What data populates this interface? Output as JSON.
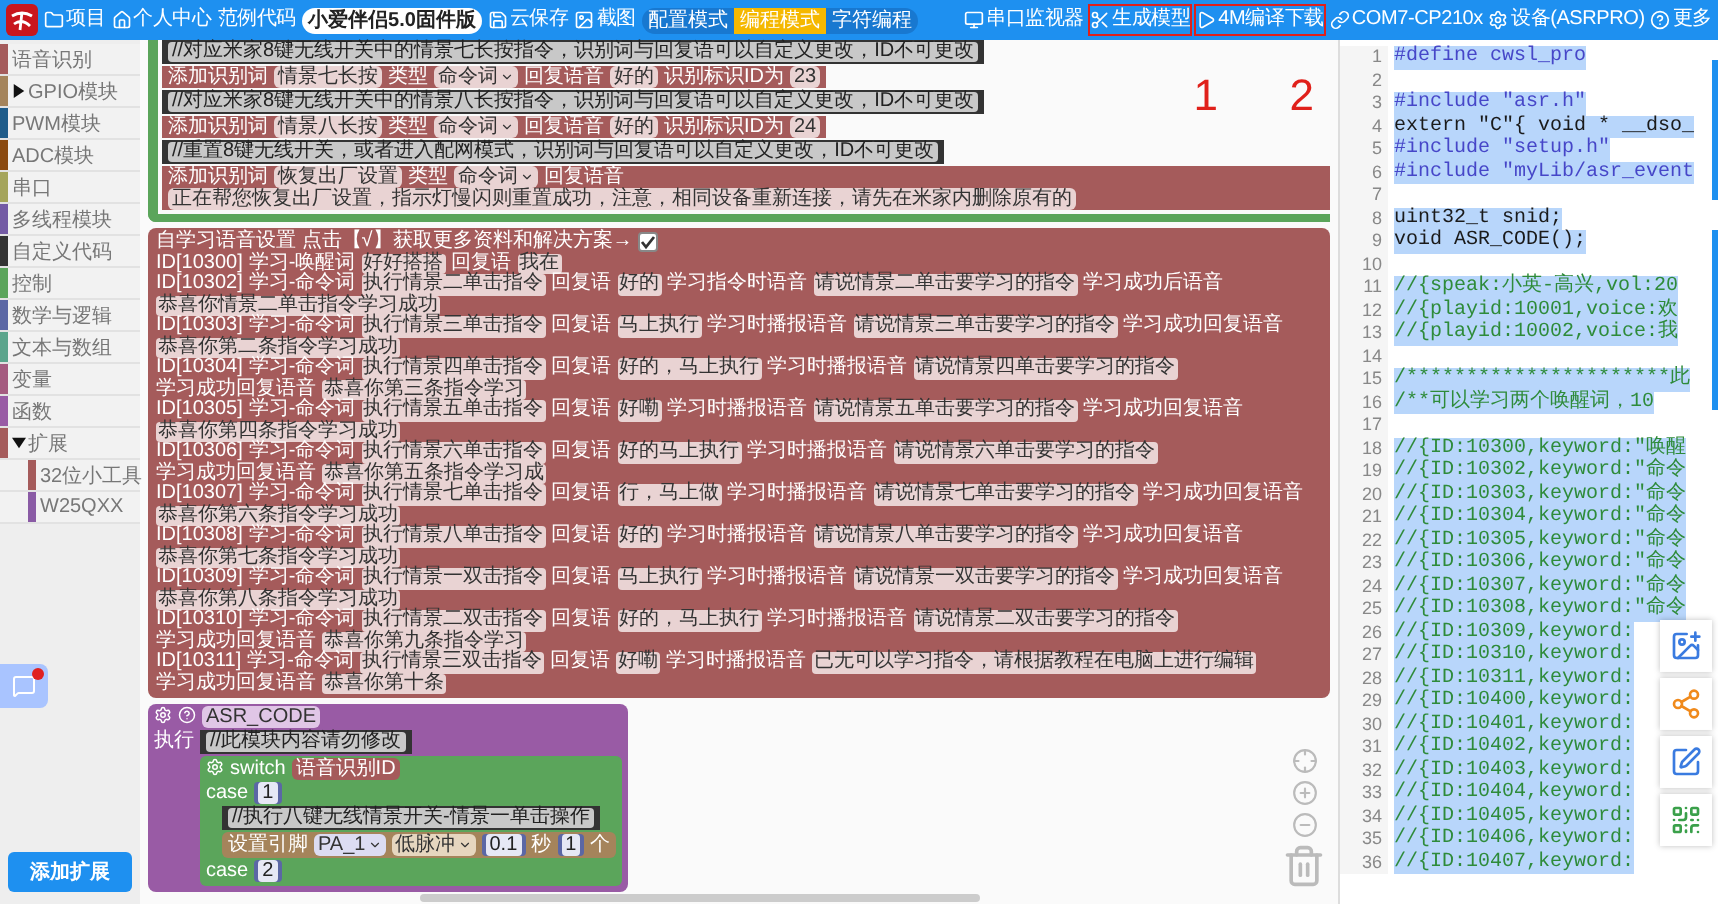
{
  "top_bar": {
    "nav": [
      {
        "label": "项目"
      },
      {
        "label": "个人中心"
      },
      {
        "label": "范例代码"
      }
    ],
    "firmware": "小爱伴侣5.0固件版",
    "file_actions": [
      {
        "label": "云保存"
      },
      {
        "label": "截图"
      }
    ],
    "modes": [
      {
        "label": "配置模式",
        "selected": false
      },
      {
        "label": "编程模式",
        "selected": true
      },
      {
        "label": "字符编程",
        "selected": false
      }
    ],
    "tools": [
      {
        "label": "串口监视器",
        "highlighted": false
      },
      {
        "label": "生成模型",
        "highlighted": true
      },
      {
        "label": "4M编译下载",
        "highlighted": true
      },
      {
        "label": "COM7-CP210x",
        "highlighted": false
      },
      {
        "label": "设备(ASRPRO)",
        "highlighted": false
      },
      {
        "label": "更多",
        "highlighted": false
      }
    ]
  },
  "sidebar": {
    "items": [
      {
        "label": "语音识别",
        "color": "#a55b5b",
        "kind": "category"
      },
      {
        "label": "GPIO模块",
        "color": "#a5845b",
        "kind": "group",
        "expanded": false
      },
      {
        "label": "PWM模块",
        "color": "#1f5c8a",
        "kind": "category"
      },
      {
        "label": "ADC模块",
        "color": "#8a4a10",
        "kind": "category"
      },
      {
        "label": "串口",
        "color": "#a5a55b",
        "kind": "category"
      },
      {
        "label": "多线程模块",
        "color": "#745ba5",
        "kind": "category"
      },
      {
        "label": "自定义代码",
        "color": "#333333",
        "kind": "category"
      },
      {
        "label": "控制",
        "color": "#5ba55b",
        "kind": "category"
      },
      {
        "label": "数学与逻辑",
        "color": "#5b67a5",
        "kind": "category"
      },
      {
        "label": "文本与数组",
        "color": "#5ba58c",
        "kind": "category"
      },
      {
        "label": "变量",
        "color": "#a55b80",
        "kind": "category"
      },
      {
        "label": "函数",
        "color": "#995ba5",
        "kind": "category"
      },
      {
        "label": "扩展",
        "color": "#a55b5b",
        "kind": "group",
        "expanded": true,
        "children": [
          {
            "label": "32位小工具",
            "color": "#a55b5b"
          },
          {
            "label": "W25QXX",
            "color": "#8a5ba5"
          }
        ]
      }
    ],
    "add_button": "添加扩展"
  },
  "workspace": {
    "annotations": [
      {
        "label": "1"
      },
      {
        "label": "2"
      }
    ],
    "top_block": [
      {
        "kind": "comment",
        "text": "//对应米家8键无线开关中的情景七长按指令，识别词与回复语可以自定义更改，ID不可更改"
      },
      {
        "kind": "word",
        "parts": [
          {
            "label": "添加识别词",
            "value": "情景七长按",
            "kind": "text"
          },
          {
            "label": "类型",
            "value": "命令词",
            "kind": "dropdown"
          },
          {
            "label": "回复语音",
            "value": "好的",
            "kind": "text"
          },
          {
            "label": "识别标识ID为",
            "value": "23",
            "kind": "text"
          }
        ]
      },
      {
        "kind": "comment",
        "text": "//对应米家8键无线开关中的情景八长按指令，识别词与回复语可以自定义更改，ID不可更改"
      },
      {
        "kind": "word",
        "parts": [
          {
            "label": "添加识别词",
            "value": "情景八长按",
            "kind": "text"
          },
          {
            "label": "类型",
            "value": "命令词",
            "kind": "dropdown"
          },
          {
            "label": "回复语音",
            "value": "好的",
            "kind": "text"
          },
          {
            "label": "识别标识ID为",
            "value": "24",
            "kind": "text"
          }
        ]
      },
      {
        "kind": "comment",
        "text": "//重置8键无线开关，或者进入配网模式，识别词与回复语可以自定义更改，ID不可更改"
      },
      {
        "kind": "word",
        "parts": [
          {
            "label": "添加识别词",
            "value": "恢复出厂设置",
            "kind": "text"
          },
          {
            "label": "类型",
            "value": "命令词",
            "kind": "dropdown"
          },
          {
            "label": "回复语音",
            "value": "正在帮您恢复出厂设置，指示灯慢闪则重置成功，注意，相同设备重新连接，请先在米家内删除原有的",
            "kind": "text"
          }
        ]
      }
    ],
    "learning_block": {
      "title": "自学习语音设置  点击【√】获取更多资料和解决方案→",
      "checked": true,
      "rows": [
        {
          "id": "ID[10300]",
          "pairs": [
            [
              "学习-唤醒词",
              "好好搭搭"
            ],
            [
              "回复语",
              "我在"
            ]
          ]
        },
        {
          "id": "ID[10302]",
          "pairs": [
            [
              "学习-命令词",
              "执行情景二单击指令"
            ],
            [
              "回复语",
              "好的"
            ],
            [
              "学习指令时语音",
              "请说情景二单击要学习的指令"
            ],
            [
              "学习成功后语音",
              "恭喜你情景二单击指令学习成功"
            ]
          ]
        },
        {
          "id": "ID[10303]",
          "pairs": [
            [
              "学习-命令词",
              "执行情景三单击指令"
            ],
            [
              "回复语",
              "马上执行"
            ],
            [
              "学习时播报语音",
              "请说情景三单击要学习的指令"
            ],
            [
              "学习成功回复语音",
              "恭喜你第二条指令学习成功"
            ]
          ]
        },
        {
          "id": "ID[10304]",
          "pairs": [
            [
              "学习-命令词",
              "执行情景四单击指令"
            ],
            [
              "回复语",
              "好的，马上执行"
            ],
            [
              "学习时播报语音",
              "请说情景四单击要学习的指令"
            ],
            [
              "学习成功回复语音",
              "恭喜你第三条指令学习"
            ]
          ]
        },
        {
          "id": "ID[10305]",
          "pairs": [
            [
              "学习-命令词",
              "执行情景五单击指令"
            ],
            [
              "回复语",
              "好嘞"
            ],
            [
              "学习时播报语音",
              "请说情景五单击要学习的指令"
            ],
            [
              "学习成功回复语音",
              "恭喜你第四条指令学习成功"
            ]
          ]
        },
        {
          "id": "ID[10306]",
          "pairs": [
            [
              "学习-命令词",
              "执行情景六单击指令"
            ],
            [
              "回复语",
              "好的马上执行"
            ],
            [
              "学习时播报语音",
              "请说情景六单击要学习的指令"
            ],
            [
              "学习成功回复语音",
              "恭喜你第五条指令学习成"
            ]
          ]
        },
        {
          "id": "ID[10307]",
          "pairs": [
            [
              "学习-命令词",
              "执行情景七单击指令"
            ],
            [
              "回复语",
              "行，马上做"
            ],
            [
              "学习时播报语音",
              "请说情景七单击要学习的指令"
            ],
            [
              "学习成功回复语音",
              "恭喜你第六条指令学习成功"
            ]
          ]
        },
        {
          "id": "ID[10308]",
          "pairs": [
            [
              "学习-命令词",
              "执行情景八单击指令"
            ],
            [
              "回复语",
              "好的"
            ],
            [
              "学习时播报语音",
              "请说情景八单击要学习的指令"
            ],
            [
              "学习成功回复语音",
              "恭喜你第七条指令学习成功"
            ]
          ]
        },
        {
          "id": "ID[10309]",
          "pairs": [
            [
              "学习-命令词",
              "执行情景一双击指令"
            ],
            [
              "回复语",
              "马上执行"
            ],
            [
              "学习时播报语音",
              "请说情景一双击要学习的指令"
            ],
            [
              "学习成功回复语音",
              "恭喜你第八条指令学习成功"
            ]
          ]
        },
        {
          "id": "ID[10310]",
          "pairs": [
            [
              "学习-命令词",
              "执行情景二双击指令"
            ],
            [
              "回复语",
              "好的，马上执行"
            ],
            [
              "学习时播报语音",
              "请说情景二双击要学习的指令"
            ],
            [
              "学习成功回复语音",
              "恭喜你第九条指令学习"
            ]
          ]
        },
        {
          "id": "ID[10311]",
          "pairs": [
            [
              "学习-命令词",
              "执行情景三双击指令"
            ],
            [
              "回复语",
              "好嘞"
            ],
            [
              "学习时播报语音",
              "已无可以学习指令，请根据教程在电脑上进行编辑"
            ],
            [
              "学习成功回复语音",
              "恭喜你第十条"
            ]
          ]
        }
      ]
    },
    "asr_block": {
      "name": "ASR_CODE",
      "do_label": "执行",
      "comment": "//此模块内容请勿修改",
      "switch_label": "switch",
      "switch_value": "语音识别ID",
      "cases": [
        {
          "label": "case",
          "value": "1",
          "comment": "//执行八键无线情景开关-情景一单击操作",
          "pin_row": {
            "label": "设置引脚",
            "pin": "PA_1",
            "mode": "低脉冲",
            "duration": "0.1",
            "unit": "秒",
            "count": "1",
            "count_unit": "个"
          }
        },
        {
          "label": "case",
          "value": "2"
        }
      ]
    }
  },
  "code_panel": {
    "lines": [
      {
        "n": "1",
        "text": "#define cwsl_pro",
        "kind": "directive"
      },
      {
        "n": "2",
        "kind": "blank"
      },
      {
        "n": "3",
        "text": "#include \"asr.h\"",
        "kind": "directive"
      },
      {
        "n": "4",
        "text": "extern \"C\"{ void * __dso_",
        "kind": "code"
      },
      {
        "n": "5",
        "text": "#include \"setup.h\"",
        "kind": "directive"
      },
      {
        "n": "6",
        "text": "#include \"myLib/asr_event",
        "kind": "directive"
      },
      {
        "n": "7",
        "kind": "blank"
      },
      {
        "n": "8",
        "text": "uint32_t snid;",
        "kind": "code"
      },
      {
        "n": "9",
        "text": "void ASR_CODE();",
        "kind": "code"
      },
      {
        "n": "10",
        "kind": "blank"
      },
      {
        "n": "11",
        "text": "//{speak:小英-高兴,vol:20",
        "kind": "comment"
      },
      {
        "n": "12",
        "text": "//{playid:10001,voice:欢",
        "kind": "comment"
      },
      {
        "n": "13",
        "text": "//{playid:10002,voice:我",
        "kind": "comment"
      },
      {
        "n": "14",
        "kind": "blank"
      },
      {
        "n": "15",
        "text": "/**********************此",
        "kind": "comment"
      },
      {
        "n": "16",
        "text": "/**可以学习两个唤醒词，10",
        "kind": "comment"
      },
      {
        "n": "17",
        "kind": "blank"
      },
      {
        "n": "18",
        "text": "//{ID:10300,keyword:\"唤醒",
        "kind": "comment"
      },
      {
        "n": "19",
        "text": "//{ID:10302,keyword:\"命令",
        "kind": "comment"
      },
      {
        "n": "20",
        "text": "//{ID:10303,keyword:\"命令",
        "kind": "comment"
      },
      {
        "n": "21",
        "text": "//{ID:10304,keyword:\"命令",
        "kind": "comment"
      },
      {
        "n": "22",
        "text": "//{ID:10305,keyword:\"命令",
        "kind": "comment"
      },
      {
        "n": "23",
        "text": "//{ID:10306,keyword:\"命令",
        "kind": "comment"
      },
      {
        "n": "24",
        "text": "//{ID:10307,keyword:\"命令",
        "kind": "comment"
      },
      {
        "n": "25",
        "text": "//{ID:10308,keyword:\"命令",
        "kind": "comment"
      },
      {
        "n": "26",
        "text": "//{ID:10309,keyword:",
        "kind": "comment"
      },
      {
        "n": "27",
        "text": "//{ID:10310,keyword:",
        "kind": "comment"
      },
      {
        "n": "28",
        "text": "//{ID:10311,keyword:",
        "kind": "comment"
      },
      {
        "n": "29",
        "text": "//{ID:10400,keyword:",
        "kind": "comment"
      },
      {
        "n": "30",
        "text": "//{ID:10401,keyword:",
        "kind": "comment"
      },
      {
        "n": "31",
        "text": "//{ID:10402,keyword:",
        "kind": "comment"
      },
      {
        "n": "32",
        "text": "//{ID:10403,keyword:",
        "kind": "comment"
      },
      {
        "n": "33",
        "text": "//{ID:10404,keyword:",
        "kind": "comment"
      },
      {
        "n": "34",
        "text": "//{ID:10405,keyword:",
        "kind": "comment"
      },
      {
        "n": "35",
        "text": "//{ID:10406,keyword:",
        "kind": "comment"
      },
      {
        "n": "36",
        "text": "//{ID:10407,keyword:",
        "kind": "comment"
      }
    ]
  }
}
